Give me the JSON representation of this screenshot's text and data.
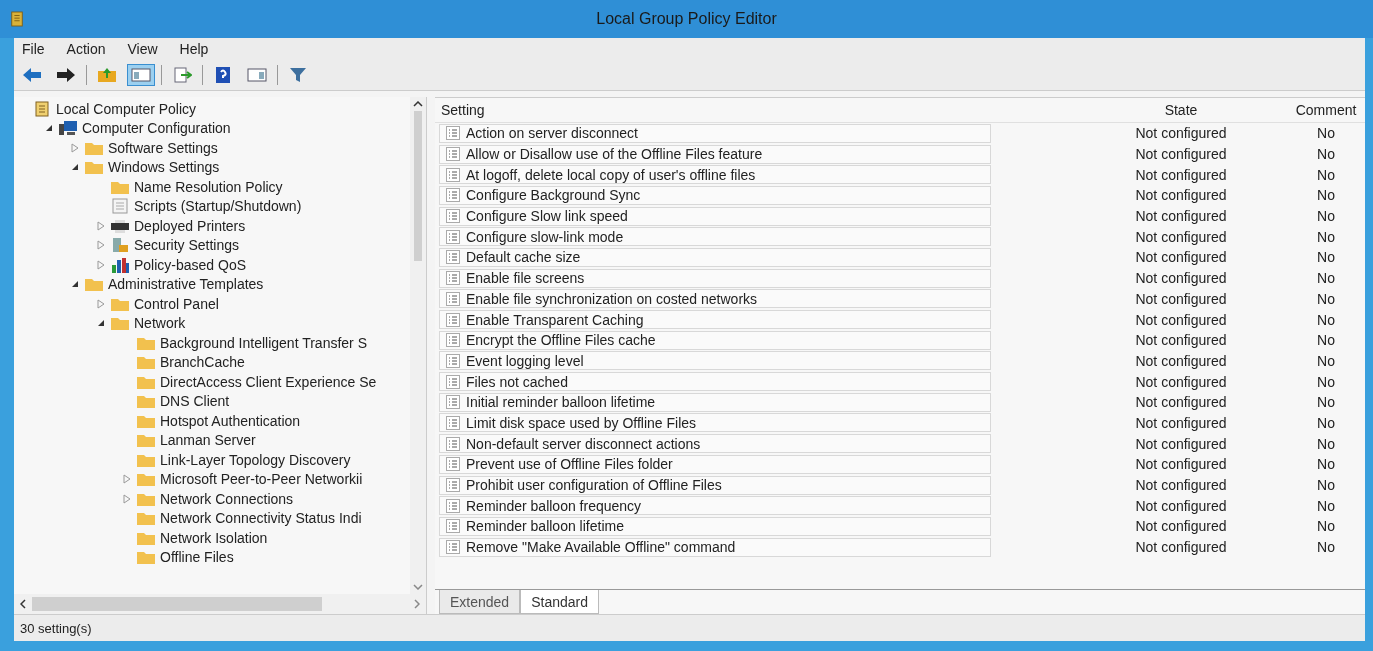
{
  "window": {
    "title": "Local Group Policy Editor"
  },
  "menu": [
    "File",
    "Action",
    "View",
    "Help"
  ],
  "toolbar": [
    {
      "kind": "back"
    },
    {
      "kind": "forward"
    },
    {
      "kind": "sep"
    },
    {
      "kind": "up"
    },
    {
      "kind": "tree",
      "pressed": true
    },
    {
      "kind": "sep"
    },
    {
      "kind": "export"
    },
    {
      "kind": "sep"
    },
    {
      "kind": "help"
    },
    {
      "kind": "panel"
    },
    {
      "kind": "sep"
    },
    {
      "kind": "filter"
    }
  ],
  "tree": [
    {
      "label": "Local Computer Policy",
      "kind": "scroll",
      "children": [
        {
          "label": "Computer Configuration",
          "kind": "computer",
          "expanded": true,
          "children": [
            {
              "label": "Software Settings",
              "kind": "folder",
              "expanded": false
            },
            {
              "label": "Windows Settings",
              "kind": "folder",
              "expanded": true,
              "children": [
                {
                  "label": "Name Resolution Policy",
                  "kind": "folder"
                },
                {
                  "label": "Scripts (Startup/Shutdown)",
                  "kind": "script"
                },
                {
                  "label": "Deployed Printers",
                  "kind": "printer",
                  "expanded": false
                },
                {
                  "label": "Security Settings",
                  "kind": "security",
                  "expanded": false
                },
                {
                  "label": "Policy-based QoS",
                  "kind": "chart",
                  "expanded": false
                }
              ]
            },
            {
              "label": "Administrative Templates",
              "kind": "folder",
              "expanded": true,
              "children": [
                {
                  "label": "Control Panel",
                  "kind": "folder",
                  "expanded": false
                },
                {
                  "label": "Network",
                  "kind": "folder",
                  "expanded": true,
                  "children": [
                    {
                      "label": "Background Intelligent Transfer S",
                      "kind": "folder"
                    },
                    {
                      "label": "BranchCache",
                      "kind": "folder"
                    },
                    {
                      "label": "DirectAccess Client Experience Se",
                      "kind": "folder"
                    },
                    {
                      "label": "DNS Client",
                      "kind": "folder"
                    },
                    {
                      "label": "Hotspot Authentication",
                      "kind": "folder"
                    },
                    {
                      "label": "Lanman Server",
                      "kind": "folder"
                    },
                    {
                      "label": "Link-Layer Topology Discovery",
                      "kind": "folder"
                    },
                    {
                      "label": "Microsoft Peer-to-Peer Networkii",
                      "kind": "folder",
                      "expanded": false
                    },
                    {
                      "label": "Network Connections",
                      "kind": "folder",
                      "expanded": false
                    },
                    {
                      "label": "Network Connectivity Status Indi",
                      "kind": "folder"
                    },
                    {
                      "label": "Network Isolation",
                      "kind": "folder"
                    },
                    {
                      "label": "Offline Files",
                      "kind": "folder"
                    }
                  ]
                }
              ]
            }
          ]
        }
      ]
    }
  ],
  "table": {
    "columns": [
      "Setting",
      "State",
      "Comment"
    ],
    "rows": [
      {
        "setting": "Action on server disconnect",
        "state": "Not configured",
        "comment": "No"
      },
      {
        "setting": "Allow or Disallow use of the Offline Files feature",
        "state": "Not configured",
        "comment": "No"
      },
      {
        "setting": "At logoff, delete local copy of user's offline files",
        "state": "Not configured",
        "comment": "No"
      },
      {
        "setting": "Configure Background Sync",
        "state": "Not configured",
        "comment": "No"
      },
      {
        "setting": "Configure Slow link speed",
        "state": "Not configured",
        "comment": "No"
      },
      {
        "setting": "Configure slow-link mode",
        "state": "Not configured",
        "comment": "No"
      },
      {
        "setting": "Default cache size",
        "state": "Not configured",
        "comment": "No"
      },
      {
        "setting": "Enable file screens",
        "state": "Not configured",
        "comment": "No"
      },
      {
        "setting": "Enable file synchronization on costed networks",
        "state": "Not configured",
        "comment": "No"
      },
      {
        "setting": "Enable Transparent Caching",
        "state": "Not configured",
        "comment": "No"
      },
      {
        "setting": "Encrypt the Offline Files cache",
        "state": "Not configured",
        "comment": "No"
      },
      {
        "setting": "Event logging level",
        "state": "Not configured",
        "comment": "No"
      },
      {
        "setting": "Files not cached",
        "state": "Not configured",
        "comment": "No"
      },
      {
        "setting": "Initial reminder balloon lifetime",
        "state": "Not configured",
        "comment": "No"
      },
      {
        "setting": "Limit disk space used by Offline Files",
        "state": "Not configured",
        "comment": "No"
      },
      {
        "setting": "Non-default server disconnect actions",
        "state": "Not configured",
        "comment": "No"
      },
      {
        "setting": "Prevent use of Offline Files folder",
        "state": "Not configured",
        "comment": "No"
      },
      {
        "setting": "Prohibit user configuration of Offline Files",
        "state": "Not configured",
        "comment": "No"
      },
      {
        "setting": "Reminder balloon frequency",
        "state": "Not configured",
        "comment": "No"
      },
      {
        "setting": "Reminder balloon lifetime",
        "state": "Not configured",
        "comment": "No"
      },
      {
        "setting": "Remove \"Make Available Offline\" command",
        "state": "Not configured",
        "comment": "No"
      }
    ]
  },
  "view_tabs": [
    {
      "label": "Extended",
      "selected": false
    },
    {
      "label": "Standard",
      "selected": true
    }
  ],
  "status_bar": "30 setting(s)"
}
